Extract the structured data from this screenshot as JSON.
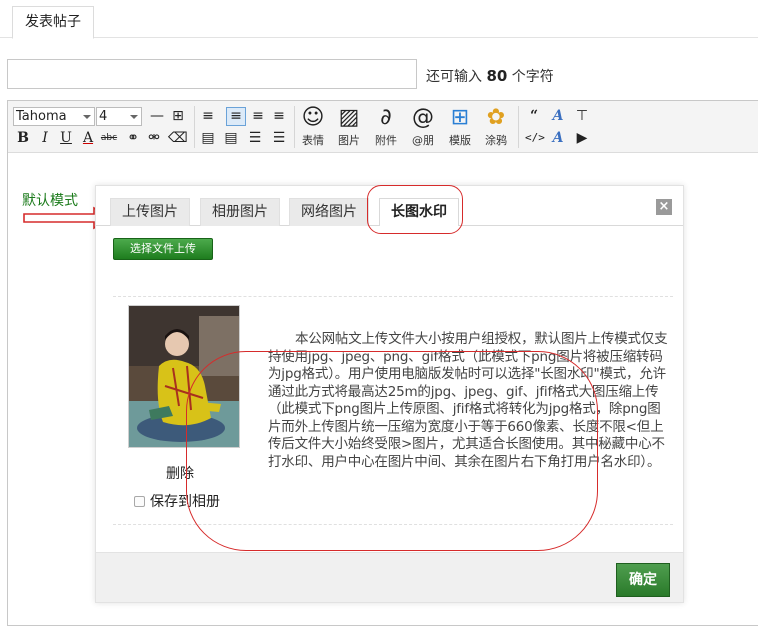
{
  "tab": {
    "label": "发表帖子"
  },
  "subject": {
    "value": "",
    "remaining_prefix": "还可输入",
    "remaining_count": "80",
    "remaining_suffix": "个字符"
  },
  "toolbar": {
    "font": "Tahoma",
    "size": "4",
    "buttons": [
      {
        "label": "表情",
        "icon": "smiley-icon"
      },
      {
        "label": "图片",
        "icon": "image-icon"
      },
      {
        "label": "附件",
        "icon": "paperclip-icon"
      },
      {
        "label": "@朋",
        "icon": "at-icon"
      },
      {
        "label": "模版",
        "icon": "template-icon"
      },
      {
        "label": "涂鸦",
        "icon": "palette-icon"
      }
    ]
  },
  "editor": {
    "mode_label": "默认模式"
  },
  "dialog": {
    "tabs": [
      "上传图片",
      "相册图片",
      "网络图片",
      "长图水印"
    ],
    "active_tab": "长图水印",
    "upload_button": "选择文件上传",
    "delete": "删除",
    "save_to_album": "保存到相册",
    "notice": "本公网帖文上传文件大小按用户组授权，默认图片上传模式仅支持使用jpg、jpeg、png、gif格式（此模式下png图片将被压缩转码为jpg格式）。用户使用电脑版发帖时可以选择\"长图水印\"模式，允许通过此方式将最高达25m的jpg、jpeg、gif、jfif格式大图压缩上传（此模式下png图片上传原图、jfif格式将转化为jpg格式，除png图片而外上传图片统一压缩为宽度小于等于660像素、长度不限<但上传后文件大小始终受限>图片，尤其适合长图使用。其中秘藏中心不打水印、用户中心在图片中间、其余在图片右下角打用户名水印）。",
    "ok_button": "确定"
  }
}
